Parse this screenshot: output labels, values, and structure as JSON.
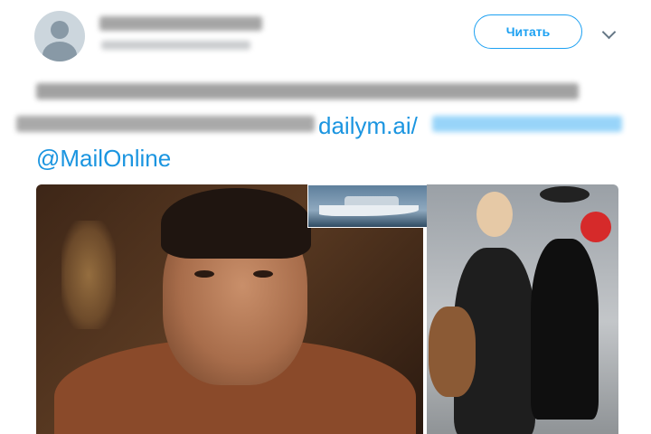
{
  "header": {
    "follow_label": "Читать"
  },
  "tweet": {
    "link_text": "dailym.ai/",
    "mention": "@MailOnline"
  },
  "icons": {
    "avatar": "default-avatar-icon",
    "menu": "chevron-down-icon"
  },
  "colors": {
    "accent": "#1da1f2",
    "link": "#1b95e0"
  }
}
